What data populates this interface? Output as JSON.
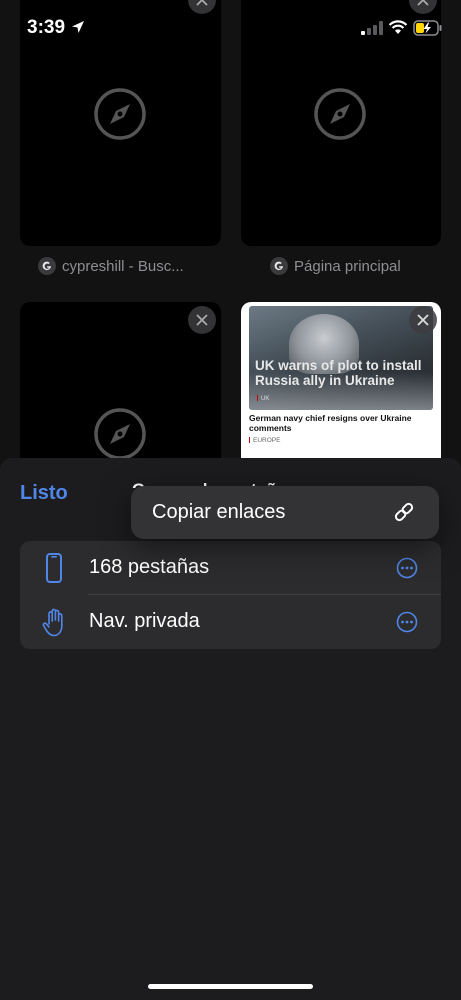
{
  "status_bar": {
    "time": "3:39"
  },
  "tabs": [
    {
      "title": "cypreshill - Busc..."
    },
    {
      "title": "Página principal"
    },
    {
      "title": ""
    },
    {
      "title": "",
      "news": {
        "headline": "UK warns of plot to install Russia ally in Ukraine",
        "tag": "UK",
        "subheadline": "German navy chief resigns over Ukraine comments",
        "sub_tag": "EUROPE"
      }
    }
  ],
  "sheet": {
    "done_label": "Listo",
    "title": "Grupos de pestañas",
    "groups": [
      {
        "label": "168 pestañas",
        "icon": "iphone-icon"
      },
      {
        "label": "Nav. privada",
        "icon": "hand-raised-icon"
      }
    ]
  },
  "context_menu": {
    "label": "Copiar enlaces",
    "icon": "link-icon"
  },
  "colors": {
    "accent": "#4f86e8",
    "sheet_bg": "#1c1c1e",
    "group_bg": "#2c2c2e",
    "menu_bg": "#333336"
  }
}
